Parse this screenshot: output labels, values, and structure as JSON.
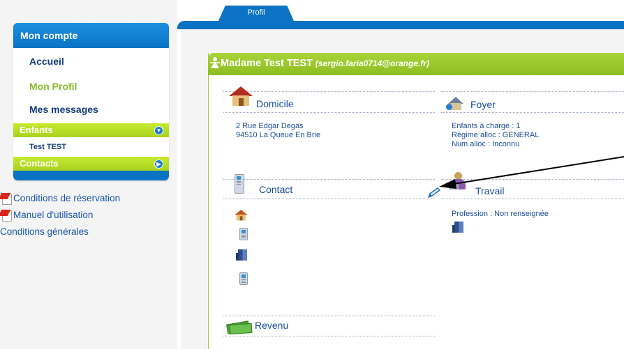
{
  "sidebar": {
    "header": "Mon compte",
    "items": {
      "accueil": "Accueil",
      "profil": "Mon Profil",
      "messages": "Mes messages"
    },
    "enfants": {
      "label": "Enfants",
      "children": [
        "Test TEST"
      ]
    },
    "contacts": {
      "label": "Contacts"
    },
    "links": [
      "Conditions de réservation",
      "Manuel d'utilisation",
      "Conditions générales"
    ]
  },
  "tabs": {
    "active": "Profil"
  },
  "profile": {
    "name": "Madame Test TEST",
    "email": "(sergio.faria0714@orange.fr)",
    "domicile": {
      "title": "Domicile",
      "lines": [
        "2 Rue Edgar Degas",
        "94510 La Queue En Brie"
      ]
    },
    "foyer": {
      "title": "Foyer",
      "lines": [
        "Enfants à charge : 1",
        "Régime alloc : GENERAL",
        "Num alloc : Inconnu"
      ]
    },
    "contact": {
      "title": "Contact"
    },
    "travail": {
      "title": "Travail",
      "lines": [
        "Profession : Non renseignée"
      ]
    },
    "revenu": {
      "title": "Revenu"
    }
  },
  "colors": {
    "brand_blue": "#0a73c3",
    "accent_green": "#a9d43a",
    "text_navy": "#143b78",
    "active_green": "#8bb92b"
  },
  "icons": [
    "house-icon",
    "phone-icon",
    "building-icon",
    "pencil-icon",
    "money-icon",
    "foyer-icon",
    "travail-icon",
    "pdf-icon",
    "person-icon",
    "expand-icon"
  ]
}
